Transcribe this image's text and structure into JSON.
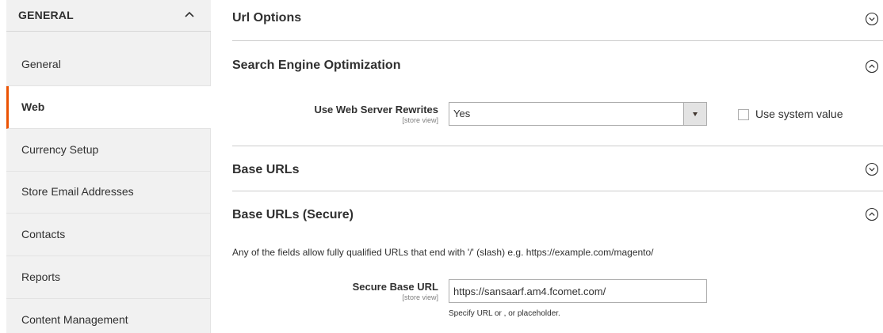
{
  "sidebar": {
    "group_label": "GENERAL",
    "items": [
      {
        "label": "General"
      },
      {
        "label": "Web"
      },
      {
        "label": "Currency Setup"
      },
      {
        "label": "Store Email Addresses"
      },
      {
        "label": "Contacts"
      },
      {
        "label": "Reports"
      },
      {
        "label": "Content Management"
      }
    ]
  },
  "sections": {
    "url_options": {
      "title": "Url Options"
    },
    "seo": {
      "title": "Search Engine Optimization",
      "rewrites_label": "Use Web Server Rewrites",
      "rewrites_scope": "[store view]",
      "rewrites_value": "Yes",
      "use_system_value_label": "Use system value"
    },
    "base_urls": {
      "title": "Base URLs"
    },
    "base_urls_secure": {
      "title": "Base URLs (Secure)",
      "hint": "Any of the fields allow fully qualified URLs that end with '/' (slash) e.g. https://example.com/magento/",
      "secure_base_url_label": "Secure Base URL",
      "secure_base_url_scope": "[store view]",
      "secure_base_url_value": "https://sansaarf.am4.fcomet.com/",
      "secure_base_url_note": "Specify URL or , or placeholder."
    }
  },
  "colors": {
    "accent": "#eb5202",
    "sidebar_bg": "#f1f1f1"
  }
}
